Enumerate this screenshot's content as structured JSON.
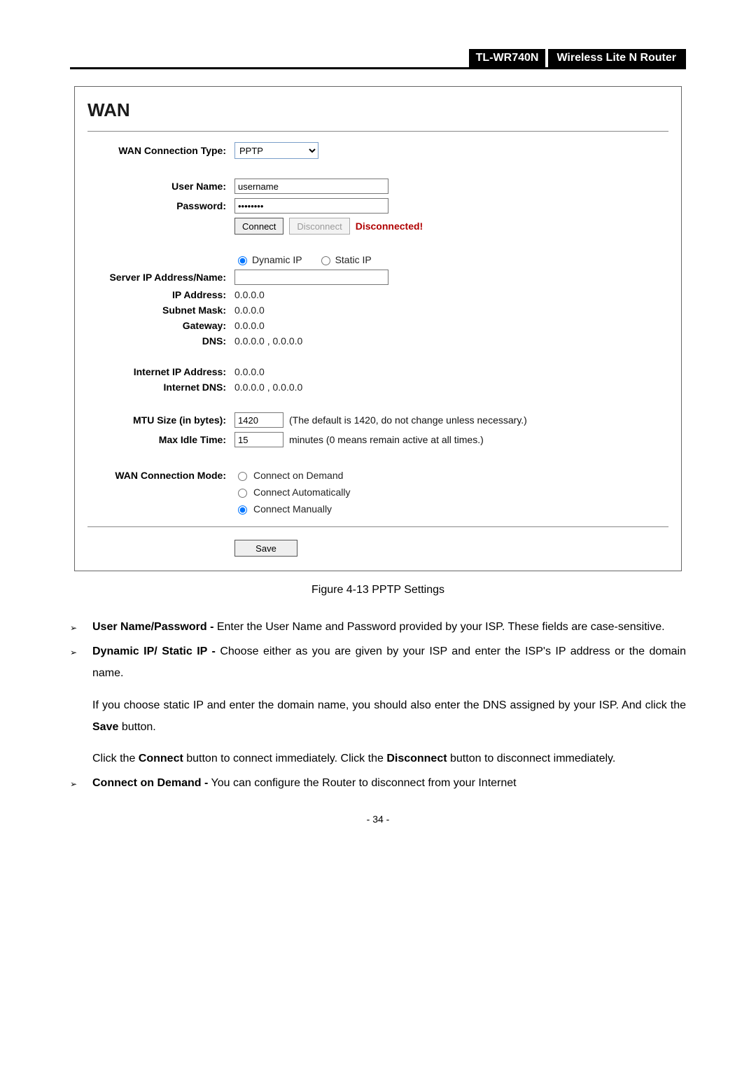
{
  "header": {
    "model": "TL-WR740N",
    "desc": "Wireless  Lite  N  Router"
  },
  "panel": {
    "title": "WAN",
    "labels": {
      "conn_type": "WAN Connection Type:",
      "user": "User Name:",
      "pass": "Password:",
      "server": "Server IP Address/Name:",
      "ip": "IP Address:",
      "mask": "Subnet Mask:",
      "gw": "Gateway:",
      "dns": "DNS:",
      "inet_ip": "Internet IP Address:",
      "inet_dns": "Internet DNS:",
      "mtu": "MTU Size (in bytes):",
      "idle": "Max Idle Time:",
      "mode": "WAN Connection Mode:"
    },
    "values": {
      "conn_type": "PPTP",
      "user": "username",
      "pass": "••••••••",
      "server": "",
      "ip": "0.0.0.0",
      "mask": "0.0.0.0",
      "gw": "0.0.0.0",
      "dns": "0.0.0.0 , 0.0.0.0",
      "inet_ip": "0.0.0.0",
      "inet_dns": "0.0.0.0 , 0.0.0.0",
      "mtu": "1420",
      "mtu_note": "(The default is 1420, do not change unless necessary.)",
      "idle": "15",
      "idle_note": "minutes (0 means remain active at all times.)"
    },
    "buttons": {
      "connect": "Connect",
      "disconnect": "Disconnect",
      "save": "Save"
    },
    "status": "Disconnected!",
    "ip_mode": {
      "dynamic": "Dynamic IP",
      "static": "Static IP"
    },
    "mode_options": {
      "on_demand": "Connect on Demand",
      "auto": "Connect Automatically",
      "manual": "Connect Manually"
    }
  },
  "figure": "Figure 4-13    PPTP Settings",
  "bullets": [
    {
      "lead": "User Name/Password -",
      "paras": [
        "Enter the User Name and Password provided by your ISP. These fields are case-sensitive."
      ]
    },
    {
      "lead": "Dynamic IP/ Static IP -",
      "paras": [
        "Choose either as you are given by your ISP and enter the ISP's IP address or the domain name.",
        "If you choose static IP and enter the domain name, you should also enter the DNS assigned by your ISP. And click the <b>Save</b> button.",
        "Click the <b>Connect</b> button to connect immediately. Click the <b>Disconnect</b> button to disconnect immediately."
      ]
    },
    {
      "lead": "Connect on Demand -",
      "paras": [
        "You can configure the Router to disconnect from your Internet"
      ]
    }
  ],
  "page_number": "- 34 -"
}
